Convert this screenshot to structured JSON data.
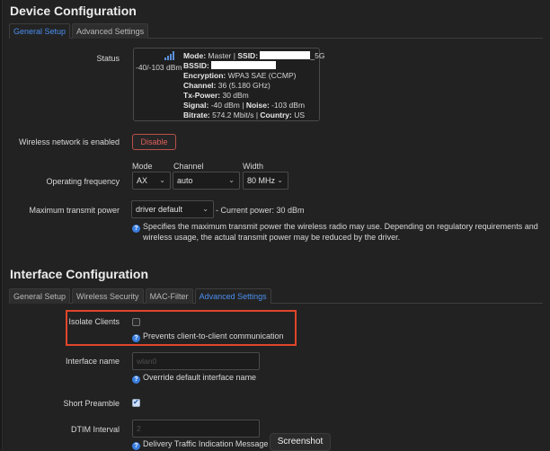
{
  "device": {
    "title": "Device Configuration",
    "tabs": [
      {
        "label": "General Setup",
        "active": true
      },
      {
        "label": "Advanced Settings",
        "active": false
      }
    ],
    "status": {
      "label": "Status",
      "signal_icon": "signal-bars-icon",
      "signal_text": "-40/-103 dBm",
      "mode_key": "Mode:",
      "mode_val": "Master",
      "ssid_key": "SSID:",
      "ssid_suffix": "_5G",
      "bssid_key": "BSSID:",
      "encryption_key": "Encryption:",
      "encryption_val": "WPA3 SAE (CCMP)",
      "channel_key": "Channel:",
      "channel_val": "36 (5.180 GHz)",
      "txpower_key": "Tx-Power:",
      "txpower_val": "30 dBm",
      "signal_key": "Signal:",
      "signal_val": "-40 dBm",
      "noise_key": "Noise:",
      "noise_val": "-103 dBm",
      "bitrate_key": "Bitrate:",
      "bitrate_val": "574.2 Mbit/s",
      "country_key": "Country:",
      "country_val": "US",
      "separator": "|"
    },
    "wireless_enabled": {
      "label": "Wireless network is enabled",
      "button": "Disable",
      "button_color": "#e0605a"
    },
    "operating_frequency": {
      "label": "Operating frequency",
      "mode_label": "Mode",
      "mode_value": "AX",
      "channel_label": "Channel",
      "channel_value": "auto",
      "width_label": "Width",
      "width_value": "80 MHz"
    },
    "max_tx_power": {
      "label": "Maximum transmit power",
      "value": "driver default",
      "current": "- Current power: 30 dBm",
      "help_line1": "Specifies the maximum transmit power the wireless radio may use. Depending on regulatory requirements and",
      "help_line2": "wireless usage, the actual transmit power may be reduced by the driver."
    }
  },
  "interface": {
    "title": "Interface Configuration",
    "tabs": [
      {
        "label": "General Setup",
        "active": false
      },
      {
        "label": "Wireless Security",
        "active": false
      },
      {
        "label": "MAC-Filter",
        "active": false
      },
      {
        "label": "Advanced Settings",
        "active": true
      }
    ],
    "isolate_clients": {
      "label": "Isolate Clients",
      "checked": false,
      "help": "Prevents client-to-client communication"
    },
    "interface_name": {
      "label": "Interface name",
      "placeholder": "wlan0",
      "help": "Override default interface name"
    },
    "short_preamble": {
      "label": "Short Preamble",
      "checked": true
    },
    "dtim_interval": {
      "label": "DTIM Interval",
      "placeholder": "2",
      "help": "Delivery Traffic Indication Message I"
    }
  },
  "overlay": {
    "tooltip": "Screenshot",
    "highlight_color": "#e0452b"
  },
  "accent_color": "#4a8ff0"
}
